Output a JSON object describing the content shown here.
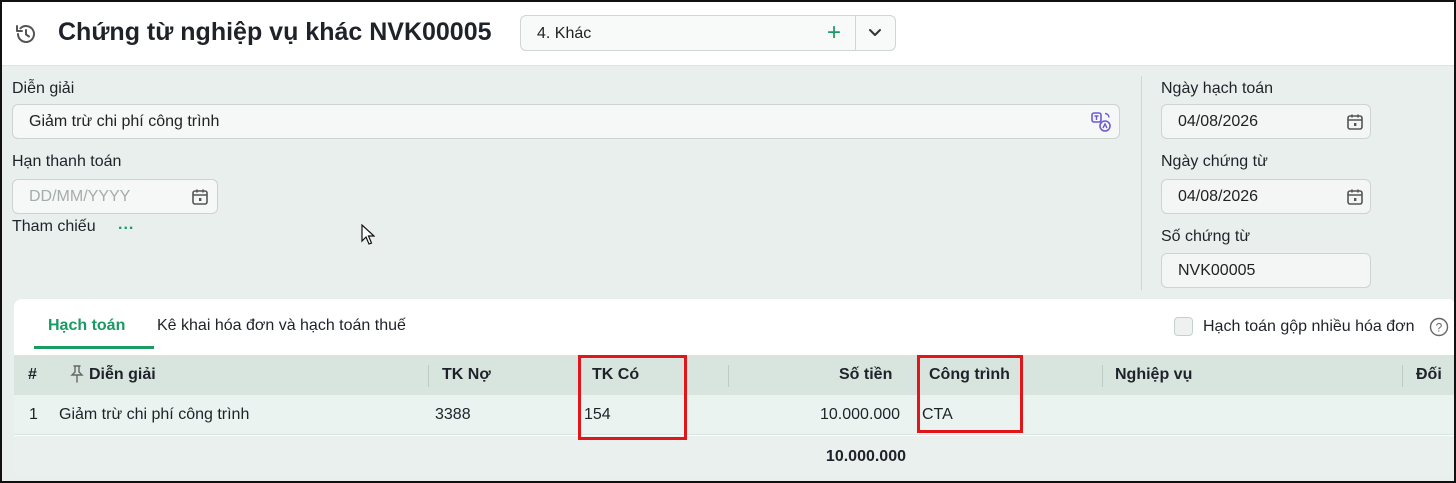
{
  "header": {
    "title": "Chứng từ nghiệp vụ khác NVK00005",
    "voucher_type": "4. Khác",
    "add_symbol": "+"
  },
  "form": {
    "description_label": "Diễn giải",
    "description_value": "Giảm trừ chi phí công trình",
    "due_date_label": "Hạn thanh toán",
    "due_date_placeholder": "DD/MM/YYYY",
    "reference_label": "Tham chiếu",
    "reference_more": "...",
    "posting_date_label": "Ngày hạch toán",
    "posting_date_value": "04/08/2026",
    "voucher_date_label": "Ngày chứng từ",
    "voucher_date_value": "04/08/2026",
    "voucher_no_label": "Số chứng từ",
    "voucher_no_value": "NVK00005"
  },
  "tabs": [
    {
      "label": "Hạch toán",
      "active": true
    },
    {
      "label": "Kê khai hóa đơn và hạch toán thuế",
      "active": false
    }
  ],
  "merge_invoices_label": "Hạch toán gộp nhiều hóa đơn",
  "help_symbol": "?",
  "table": {
    "columns": [
      "#",
      "Diễn giải",
      "TK Nợ",
      "TK Có",
      "Số tiền",
      "Công trình",
      "Nghiệp vụ",
      "Đối"
    ],
    "rows": [
      [
        "1",
        "Giảm trừ chi phí công trình",
        "3388",
        "154",
        "10.000.000",
        "CTA",
        "",
        ""
      ]
    ],
    "total": "10.000.000"
  },
  "colors": {
    "accent": "#1a9b63",
    "highlight": "#e0161b"
  }
}
